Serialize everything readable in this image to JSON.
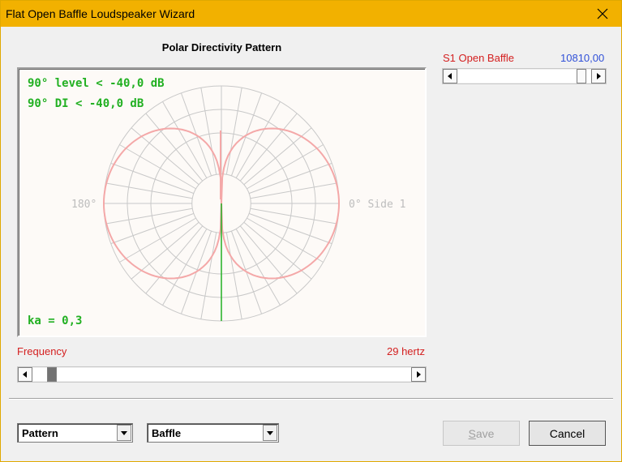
{
  "window": {
    "title": "Flat Open Baffle Loudspeaker Wizard",
    "accent_color": "#f2b100",
    "close_icon": "close-icon"
  },
  "polar": {
    "title": "Polar Directivity Pattern",
    "level_text": "90° level < -40,0 dB",
    "di_text": "90° DI < -40,0 dB",
    "ka_text": "ka = 0,3",
    "angle_left": "180°",
    "angle_right": "0° Side 1",
    "pattern_color": "#f4a8a8",
    "response_color": "#22b022",
    "grid_color": "#c8c8c8"
  },
  "frequency": {
    "label": "Frequency",
    "value_text": "29 hertz",
    "position_fraction": 0.04
  },
  "s1": {
    "label": "S1  Open Baffle",
    "value_text": "10810,00",
    "position_fraction": 0.95
  },
  "controls": {
    "pattern_combo": "Pattern",
    "baffle_combo": "Baffle",
    "save_label": "Save",
    "cancel_label": "Cancel"
  }
}
